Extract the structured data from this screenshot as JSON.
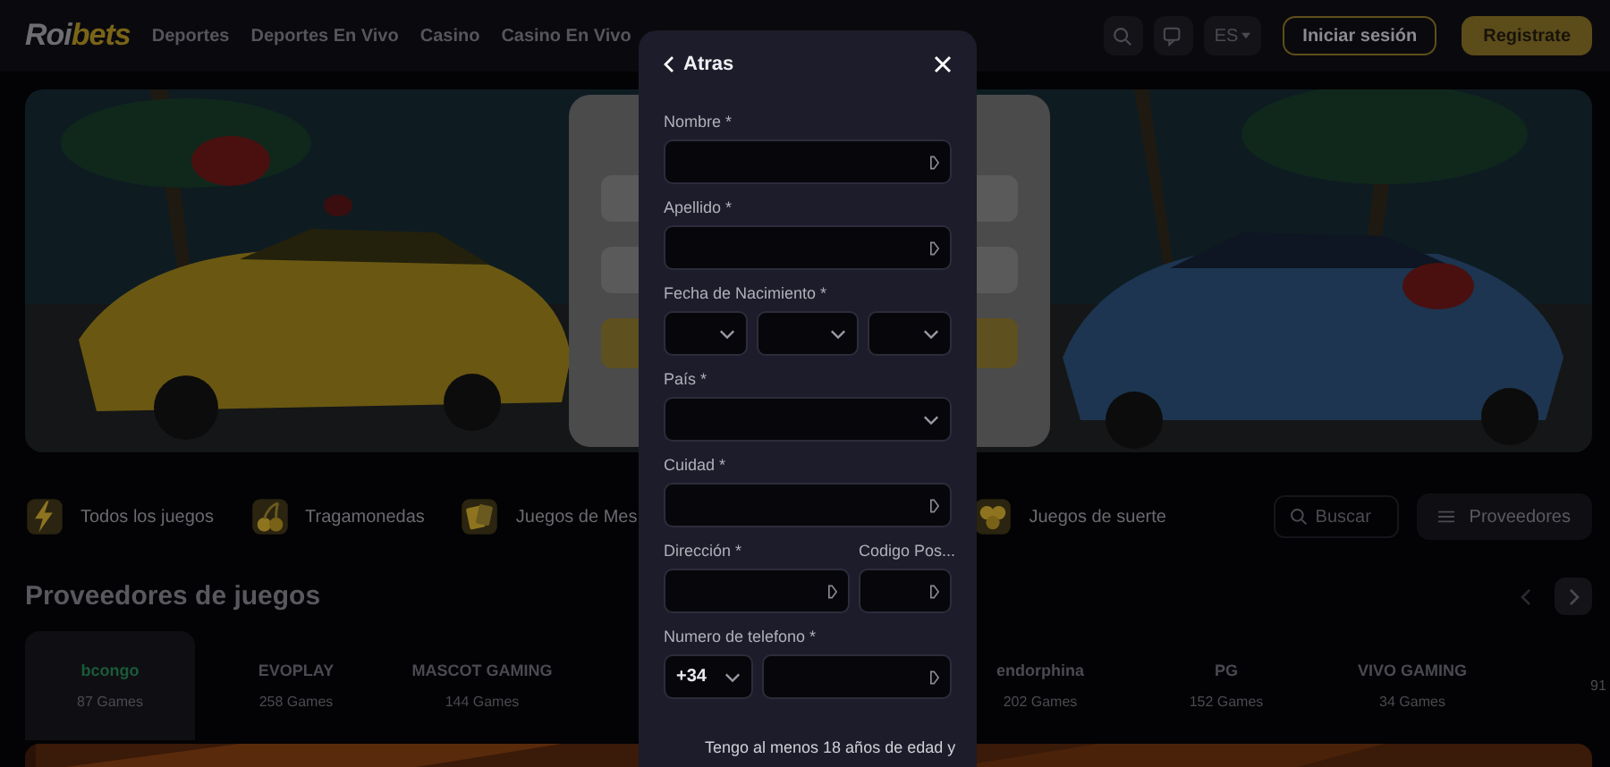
{
  "header": {
    "logo_main": "Roi",
    "logo_accent": "bets",
    "nav": [
      "Deportes",
      "Deportes En Vivo",
      "Casino",
      "Casino En Vivo"
    ],
    "language": "ES",
    "login": "Iniciar sesión",
    "register": "Registrate"
  },
  "categories": [
    {
      "label": "Todos los juegos"
    },
    {
      "label": "Tragamonedas"
    },
    {
      "label": "Juegos de Mes"
    },
    {
      "label": "Juegos de suerte"
    }
  ],
  "search": {
    "placeholder": "Buscar"
  },
  "providers_button": "Proveedores",
  "providers": {
    "title": "Proveedores de juegos",
    "left": [
      {
        "logo": "bcongo",
        "count": "87 Games",
        "selected": true
      },
      {
        "logo": "EVOPLAY",
        "count": "258 Games",
        "selected": false
      },
      {
        "logo": "MASCOT GAMING",
        "count": "144 Games",
        "selected": false
      }
    ],
    "right": [
      {
        "logo": "endorphina",
        "count": "202 Games",
        "selected": false
      },
      {
        "logo": "PG",
        "count": "152 Games",
        "selected": false
      },
      {
        "logo": "VIVO GAMING",
        "count": "34 Games",
        "selected": false
      },
      {
        "count": "91",
        "selected": false
      }
    ]
  },
  "modal": {
    "back": "Atras",
    "rows": [
      {
        "groups": [
          {
            "label": "Nombre *",
            "fields": [
              {
                "kind": "text"
              }
            ]
          }
        ]
      },
      {
        "groups": [
          {
            "label": "Apellido *",
            "fields": [
              {
                "kind": "text"
              }
            ]
          }
        ]
      },
      {
        "groups": [
          {
            "label": "Fecha de Nacimiento *",
            "fields": [
              {
                "kind": "select"
              },
              {
                "kind": "select"
              },
              {
                "kind": "select"
              }
            ]
          }
        ]
      },
      {
        "groups": [
          {
            "label": "País *",
            "fields": [
              {
                "kind": "select"
              }
            ]
          }
        ]
      },
      {
        "groups": [
          {
            "label": "Cuidad *",
            "fields": [
              {
                "kind": "text"
              }
            ]
          }
        ]
      },
      {
        "groups": [
          {
            "label": "Dirección *",
            "fields": [
              {
                "kind": "text"
              }
            ]
          },
          {
            "label": "Codigo Pos...",
            "fields": [
              {
                "kind": "text"
              }
            ]
          }
        ]
      },
      {
        "groups": [
          {
            "label": "Numero de telefono *",
            "fields": [
              {
                "kind": "select",
                "value": "+34"
              },
              {
                "kind": "text"
              }
            ]
          }
        ]
      }
    ],
    "consent": "Tengo al menos 18 años de edad y"
  }
}
